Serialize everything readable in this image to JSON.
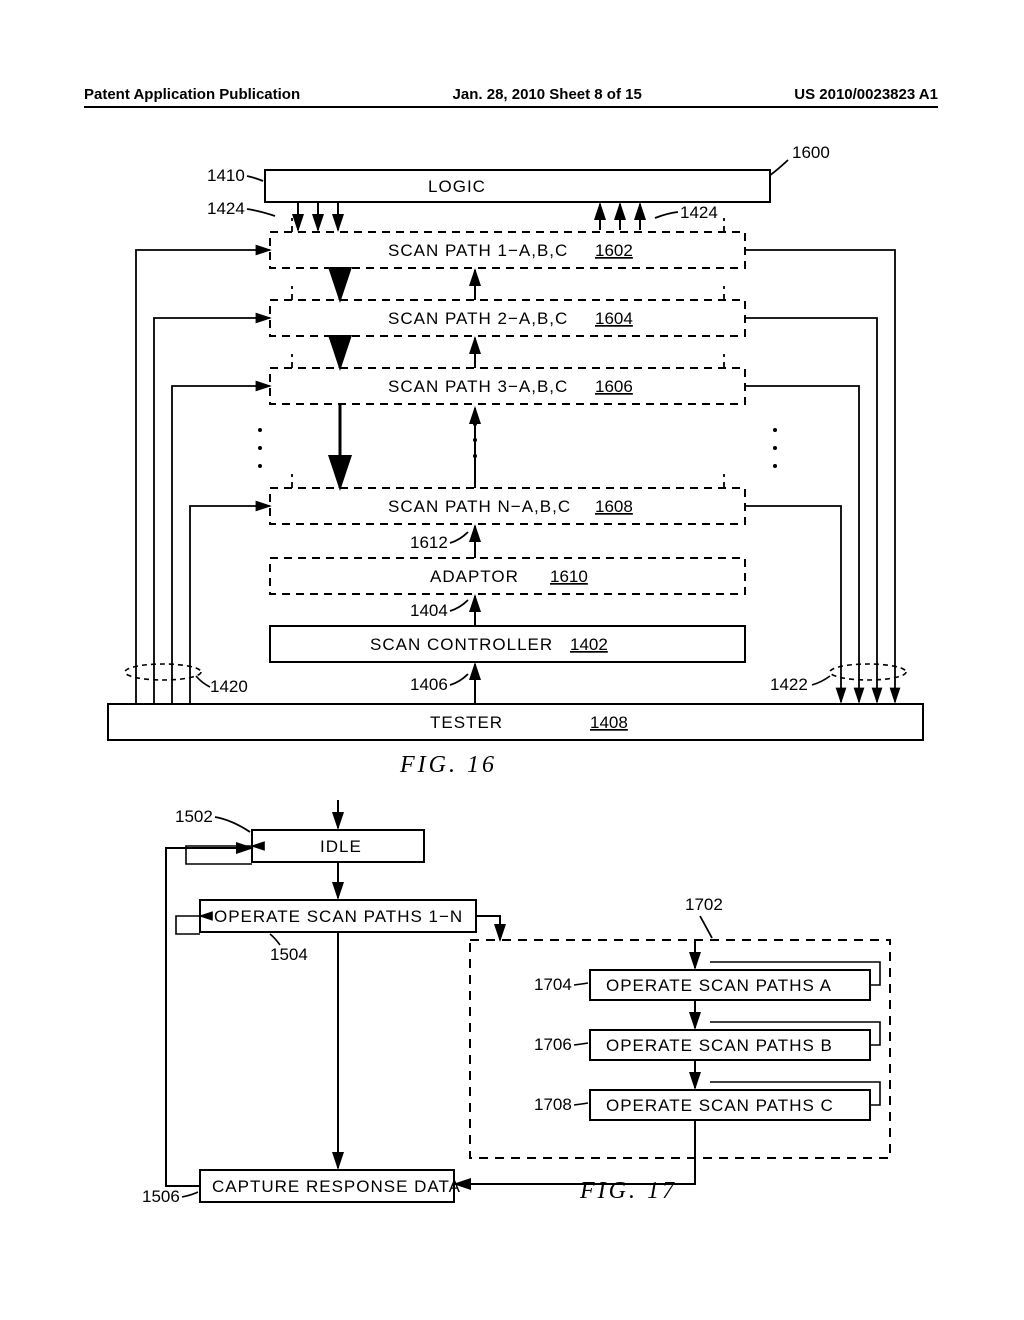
{
  "header": {
    "left": "Patent Application Publication",
    "center": "Jan. 28, 2010  Sheet 8 of 15",
    "right": "US 2010/0023823 A1"
  },
  "fig16": {
    "title": "FIG.   16",
    "logic": "LOGIC",
    "sp1": "SCAN PATH 1−A,B,C",
    "sp2": "SCAN PATH 2−A,B,C",
    "sp3": "SCAN PATH 3−A,B,C",
    "spn": "SCAN PATH N−A,B,C",
    "adaptor": "ADAPTOR",
    "scanctrl": "SCAN CONTROLLER",
    "tester": "TESTER",
    "ref1600": "1600",
    "ref1410": "1410",
    "ref1424a": "1424",
    "ref1424b": "1424",
    "ref1602": "1602",
    "ref1604": "1604",
    "ref1606": "1606",
    "ref1608": "1608",
    "ref1612": "1612",
    "ref1610": "1610",
    "ref1404": "1404",
    "ref1402": "1402",
    "ref1420": "1420",
    "ref1406": "1406",
    "ref1422": "1422",
    "ref1408": "1408"
  },
  "fig17": {
    "title": "FIG.   17",
    "idle": "IDLE",
    "op1n": "OPERATE SCAN PATHS 1−N",
    "opa": "OPERATE SCAN PATHS A",
    "opb": "OPERATE SCAN PATHS B",
    "opc": "OPERATE SCAN PATHS C",
    "capture": "CAPTURE RESPONSE DATA",
    "ref1502": "1502",
    "ref1504": "1504",
    "ref1702": "1702",
    "ref1704": "1704",
    "ref1706": "1706",
    "ref1708": "1708",
    "ref1506": "1506"
  }
}
